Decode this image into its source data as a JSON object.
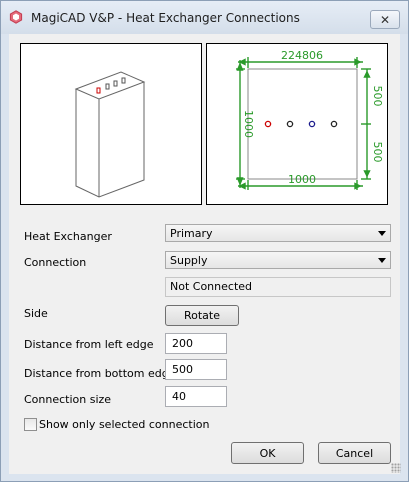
{
  "window": {
    "title": "MagiCAD V&P - Heat Exchanger Connections",
    "close_glyph": "✕",
    "app_icon": "magicad-logo-icon"
  },
  "preview": {
    "dimension_labels": {
      "top": "224806",
      "bottom": "1000",
      "left": "1000",
      "right_upper": "500",
      "right_lower": "500"
    }
  },
  "form": {
    "heat_exchanger": {
      "label": "Heat Exchanger",
      "value": "Primary"
    },
    "connection": {
      "label": "Connection",
      "value": "Supply"
    },
    "connection_status": "Not Connected",
    "side": {
      "label": "Side",
      "button_label": "Rotate"
    },
    "distance_left": {
      "label": "Distance from left edge",
      "value": "200"
    },
    "distance_bottom": {
      "label": "Distance from bottom edge",
      "value": "500"
    },
    "connection_size": {
      "label": "Connection size",
      "value": "40"
    },
    "show_only_selected": {
      "label": "Show only selected connection",
      "checked": false
    }
  },
  "buttons": {
    "ok": "OK",
    "cancel": "Cancel"
  },
  "colors": {
    "dimension_green": "#2a9a2a",
    "selected_connection_red": "#cc0000",
    "connection_blue": "#1a1a8c"
  }
}
